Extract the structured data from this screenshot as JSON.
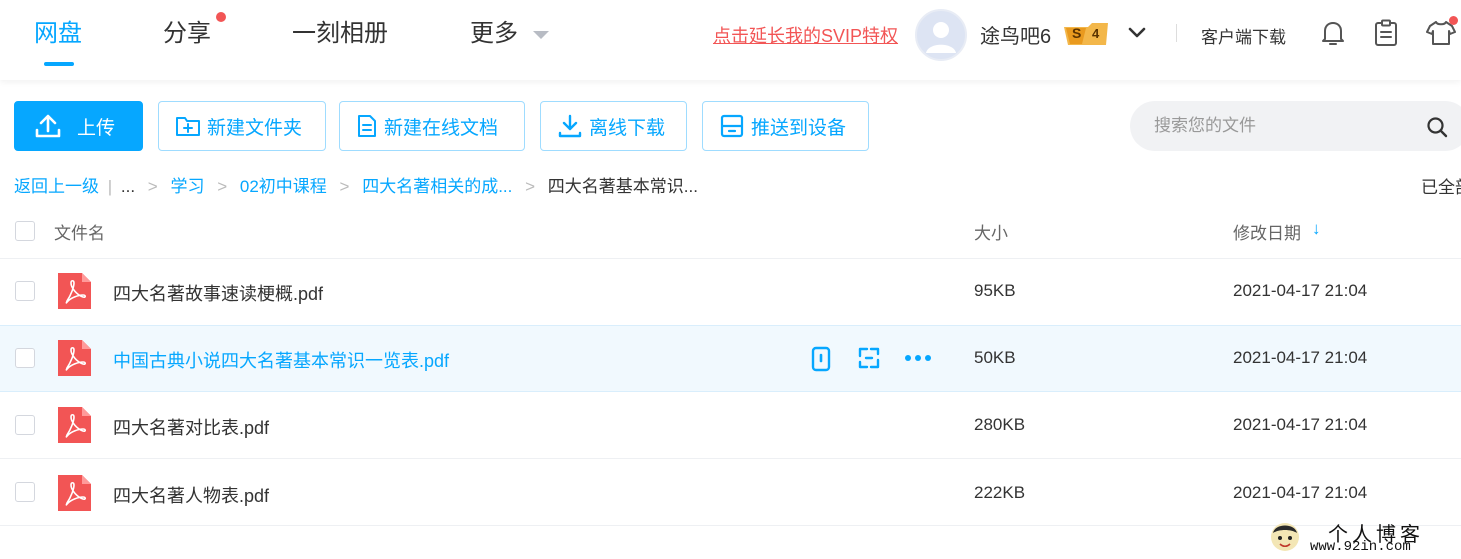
{
  "nav": {
    "items": [
      "网盘",
      "分享",
      "一刻相册",
      "更多"
    ],
    "active": "网盘"
  },
  "header": {
    "svip_link": "点击延长我的SVIP特权",
    "username": "途鸟吧6",
    "badge": {
      "letter": "S",
      "level": "4"
    },
    "client_download": "客户端下载"
  },
  "toolbar": {
    "upload": "上传",
    "new_folder": "新建文件夹",
    "new_doc": "新建在线文档",
    "offline_download": "离线下载",
    "push_device": "推送到设备"
  },
  "search": {
    "placeholder": "搜索您的文件"
  },
  "breadcrumb": {
    "back": "返回上一级",
    "ellipsis": "...",
    "path": [
      "学习",
      "02初中课程",
      "四大名著相关的成...",
      "四大名著基本常识..."
    ],
    "status": "已全部"
  },
  "table": {
    "headers": {
      "name": "文件名",
      "size": "大小",
      "date": "修改日期"
    },
    "sort_indicator": "↓",
    "rows": [
      {
        "name": "四大名著故事速读梗概.pdf",
        "size": "95KB",
        "date": "2021-04-17 21:04"
      },
      {
        "name": "中国古典小说四大名著基本常识一览表.pdf",
        "size": "50KB",
        "date": "2021-04-17 21:04"
      },
      {
        "name": "四大名著对比表.pdf",
        "size": "280KB",
        "date": "2021-04-17 21:04"
      },
      {
        "name": "四大名著人物表.pdf",
        "size": "222KB",
        "date": "2021-04-17 21:04"
      }
    ],
    "hovered_row": 1
  },
  "watermark": {
    "title": "个人博客",
    "url": "www.92in.com"
  },
  "colors": {
    "accent": "#06a7ff",
    "alert": "#f25555",
    "pdf": "#f25555"
  }
}
